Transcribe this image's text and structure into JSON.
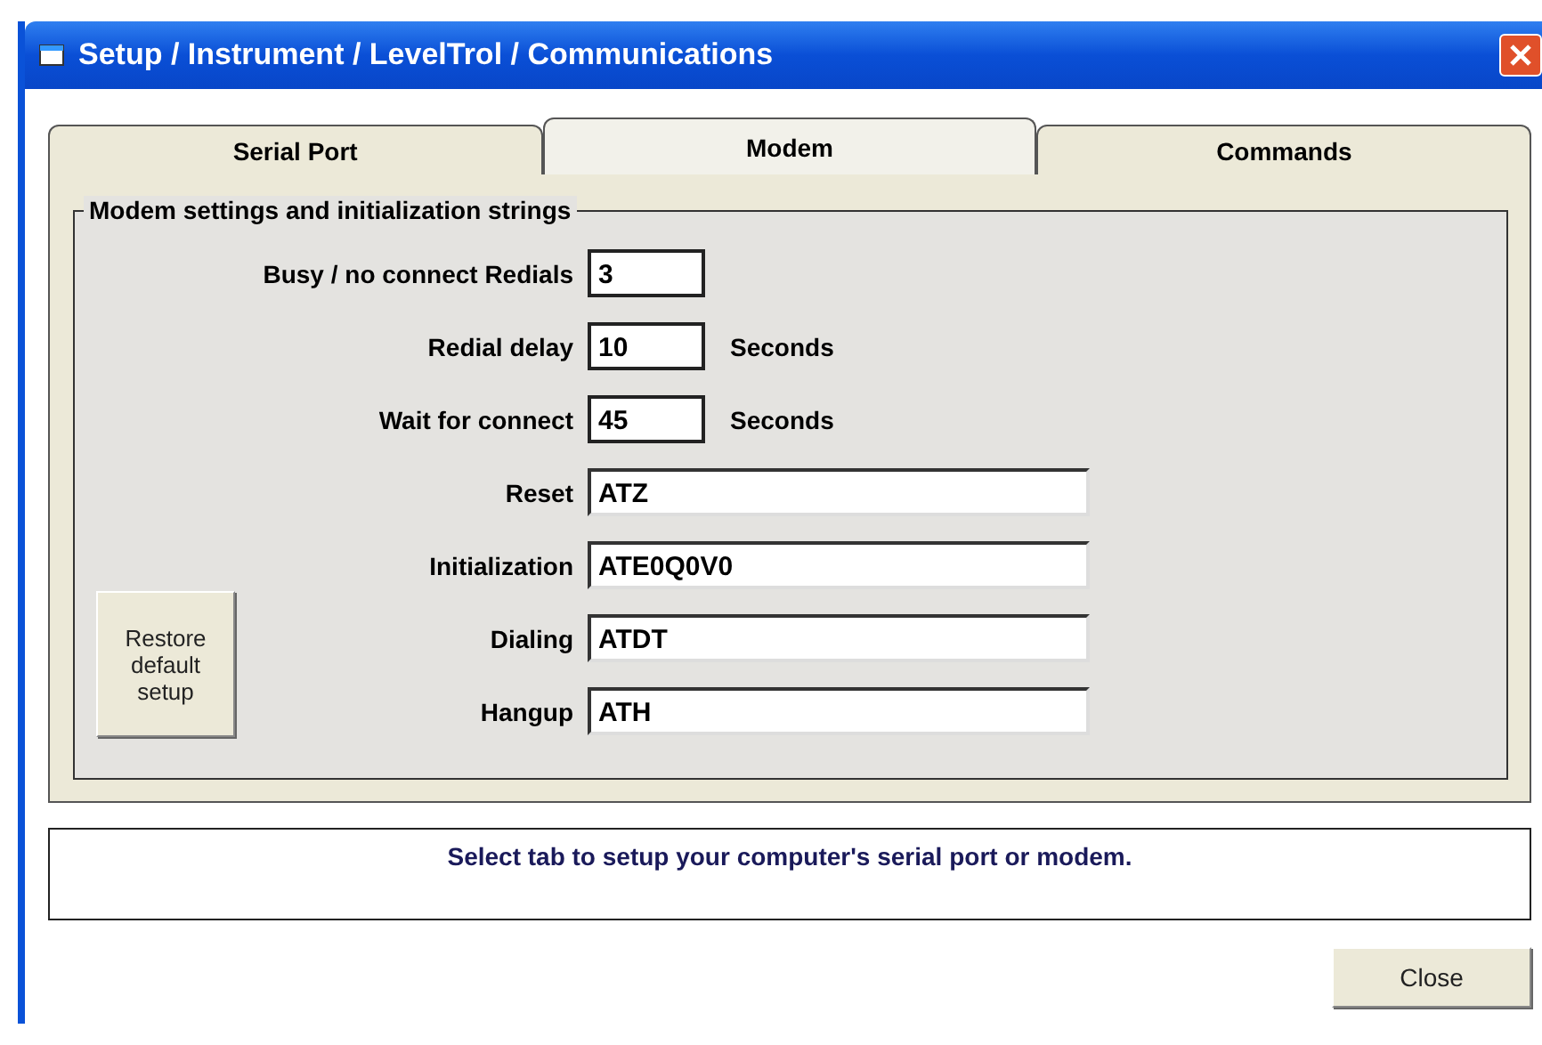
{
  "window": {
    "title": "Setup / Instrument / LevelTrol / Communications"
  },
  "tabs": [
    {
      "label": "Serial Port",
      "selected": false
    },
    {
      "label": "Modem",
      "selected": true
    },
    {
      "label": "Commands",
      "selected": false
    }
  ],
  "group": {
    "title": "Modem settings and initialization strings",
    "fields": [
      {
        "kind": "short",
        "label": "Busy / no connect Redials",
        "value": "3"
      },
      {
        "kind": "short",
        "label": "Redial delay",
        "value": "10",
        "unit": "Seconds"
      },
      {
        "kind": "short",
        "label": "Wait for connect",
        "value": "45",
        "unit": "Seconds"
      },
      {
        "kind": "long",
        "label": "Reset",
        "value": "ATZ"
      },
      {
        "kind": "long",
        "label": "Initialization",
        "value": "ATE0Q0V0"
      },
      {
        "kind": "long",
        "label": "Dialing",
        "value": "ATDT"
      },
      {
        "kind": "long",
        "label": "Hangup",
        "value": "ATH"
      }
    ],
    "restore_button": "Restore default setup"
  },
  "status_message": "Select tab to setup your computer's serial port or modem.",
  "buttons": [
    "Close"
  ]
}
